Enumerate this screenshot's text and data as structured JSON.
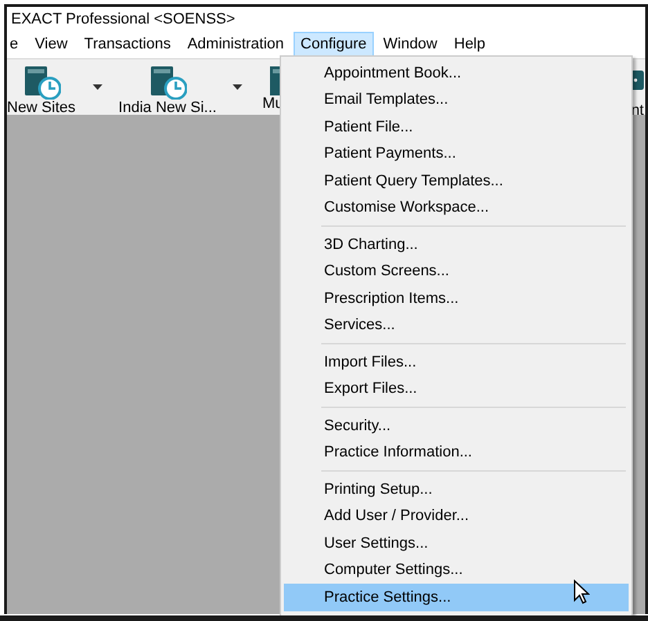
{
  "window": {
    "title": "EXACT Professional <SOENSS>"
  },
  "menu_bar": [
    {
      "label": "e",
      "selected": false
    },
    {
      "label": "View",
      "selected": false
    },
    {
      "label": "Transactions",
      "selected": false
    },
    {
      "label": "Administration",
      "selected": false
    },
    {
      "label": "Configure",
      "selected": true
    },
    {
      "label": "Window",
      "selected": false
    },
    {
      "label": "Help",
      "selected": false
    }
  ],
  "toolbar": [
    {
      "kind": "full",
      "label": "New Sites",
      "dropdown": true
    },
    {
      "kind": "full",
      "label": "India New Si...",
      "dropdown": true
    },
    {
      "kind": "cut_left",
      "label": "Mu",
      "dropdown": false
    },
    {
      "kind": "cut_right",
      "label": "nt",
      "dropdown": false
    }
  ],
  "menu": {
    "groups": [
      [
        {
          "label": "Appointment Book...",
          "selected": false
        },
        {
          "label": "Email Templates...",
          "selected": false
        },
        {
          "label": "Patient File...",
          "selected": false
        },
        {
          "label": "Patient Payments...",
          "selected": false
        },
        {
          "label": "Patient Query Templates...",
          "selected": false
        },
        {
          "label": "Customise Workspace...",
          "selected": false
        }
      ],
      [
        {
          "label": "3D Charting...",
          "selected": false
        },
        {
          "label": "Custom Screens...",
          "selected": false
        },
        {
          "label": "Prescription Items...",
          "selected": false
        },
        {
          "label": "Services...",
          "selected": false
        }
      ],
      [
        {
          "label": "Import Files...",
          "selected": false
        },
        {
          "label": "Export Files...",
          "selected": false
        }
      ],
      [
        {
          "label": "Security...",
          "selected": false
        },
        {
          "label": "Practice Information...",
          "selected": false
        }
      ],
      [
        {
          "label": "Printing Setup...",
          "selected": false
        },
        {
          "label": "Add User / Provider...",
          "selected": false
        },
        {
          "label": "User Settings...",
          "selected": false
        },
        {
          "label": "Computer Settings...",
          "selected": false
        },
        {
          "label": "Practice Settings...",
          "selected": true
        }
      ]
    ]
  }
}
